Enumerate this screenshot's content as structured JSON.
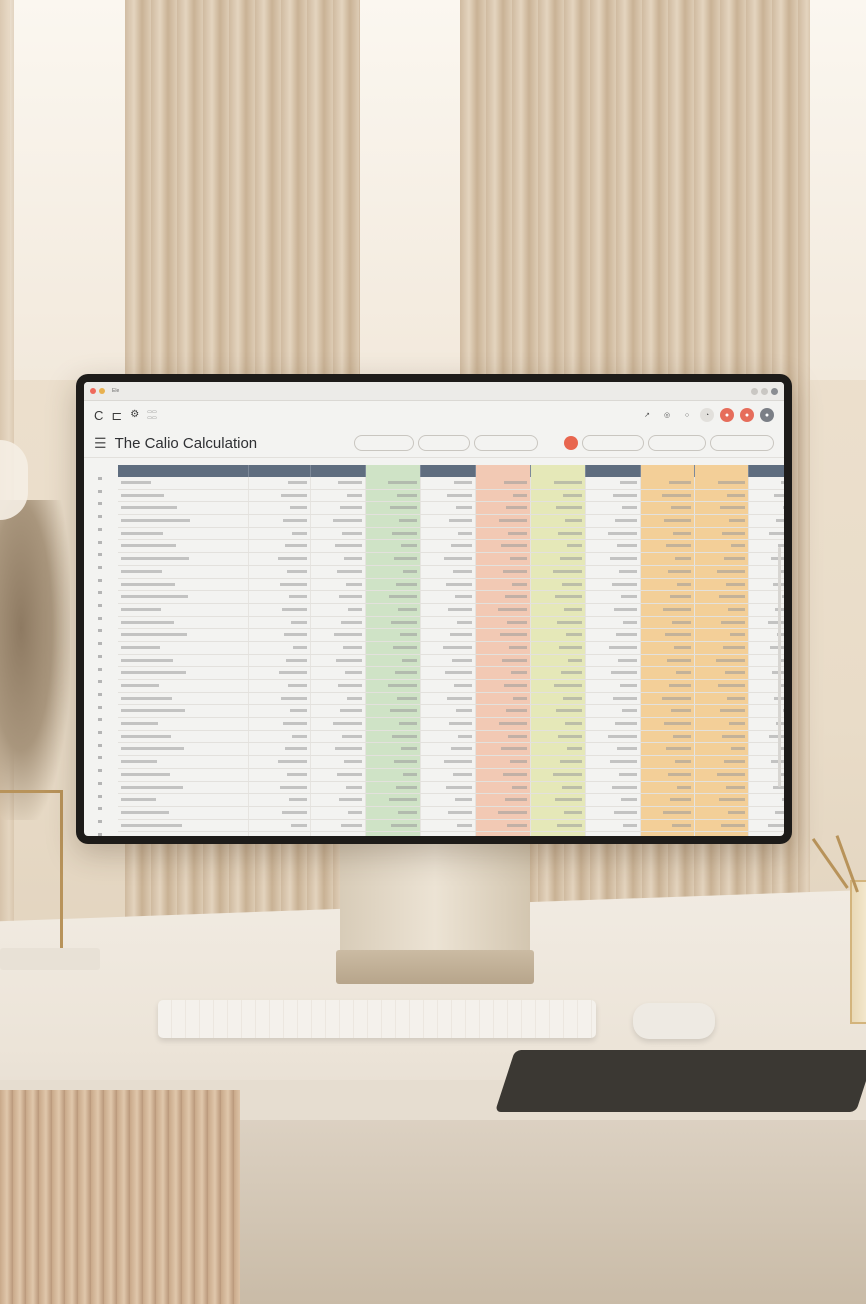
{
  "app": {
    "window_title": "Ele",
    "title": "The Calio Calculation"
  },
  "titlebar": {
    "text": "Ele"
  },
  "toolbar": {
    "back_label": "C",
    "forward_label": "⊏"
  },
  "header": {
    "menu_icon": "hamburger-menu-icon",
    "title": "The Calio Calculation"
  },
  "colors": {
    "header_row": "#5f6d7f",
    "col_green": "#cfe3c6",
    "col_salmon": "#f2c9b4",
    "col_yellow": "#e5e8b8",
    "col_orange": "#f3cf98",
    "accent_red": "#e66d5b"
  },
  "sheet": {
    "column_tints": [
      "",
      "",
      "",
      "green",
      "",
      "salmon",
      "yellow",
      "",
      "orange",
      "orange",
      ""
    ],
    "row_count": 29
  }
}
